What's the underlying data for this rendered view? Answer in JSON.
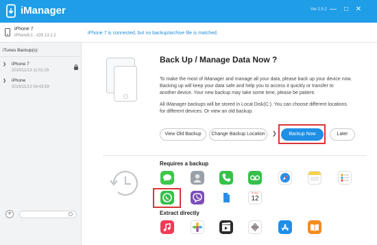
{
  "titlebar": {
    "title": "iManager",
    "version": "Ver:2.5.2",
    "minimize": "—",
    "maximize": "□",
    "close": "✕"
  },
  "device": {
    "name": "iPhone 7",
    "model": "iPhone9,1 - iOS 13.1.2",
    "status": "iPhone 7 is connected, but no backup/archive file is matched."
  },
  "sidebar": {
    "header": "iTunes Backup(s):",
    "items": [
      {
        "name": "iPhone 7",
        "date": "2019/11/13 11:02:29",
        "locked": true
      },
      {
        "name": "iPhone",
        "date": "2019/11/13 08:43:59",
        "locked": false
      }
    ],
    "add_label": "+"
  },
  "main": {
    "title": "Back Up / Manage Data Now ?",
    "paragraph1": [
      "To make the most of iManager and manage all your data, please back up your device now.",
      "Backing up will keep your data safe and help you to access it quickly or transfer to",
      "another device. Your new backup may take some time, please be patient."
    ],
    "paragraph2": [
      "All iManager backups will be stored in Local Disk(C:). You can choose different locations",
      "for different devices. Or view an old backup."
    ],
    "buttons": {
      "view_old": "View Old Backup",
      "change_location": "Change Backup Location",
      "backup_now": "Backup Now",
      "later": "Later"
    },
    "requires_label": "Requires a backup",
    "extract_label": "Extract directly",
    "calendar_day": "Monday",
    "calendar_date": "12",
    "requires_icons": [
      "messages-icon",
      "contacts-icon",
      "phone-icon",
      "voicemail-icon",
      "safari-icon",
      "notes-icon",
      "reminders-icon",
      "whatsapp-icon",
      "viber-icon",
      "files-icon",
      "calendar-icon"
    ],
    "extract_icons": [
      "music-icon",
      "photos-icon",
      "videos-icon",
      "voice-memos-icon",
      "app-store-icon",
      "books-icon"
    ]
  },
  "colors": {
    "accent": "#1f9de6",
    "highlight": "#d93434"
  }
}
